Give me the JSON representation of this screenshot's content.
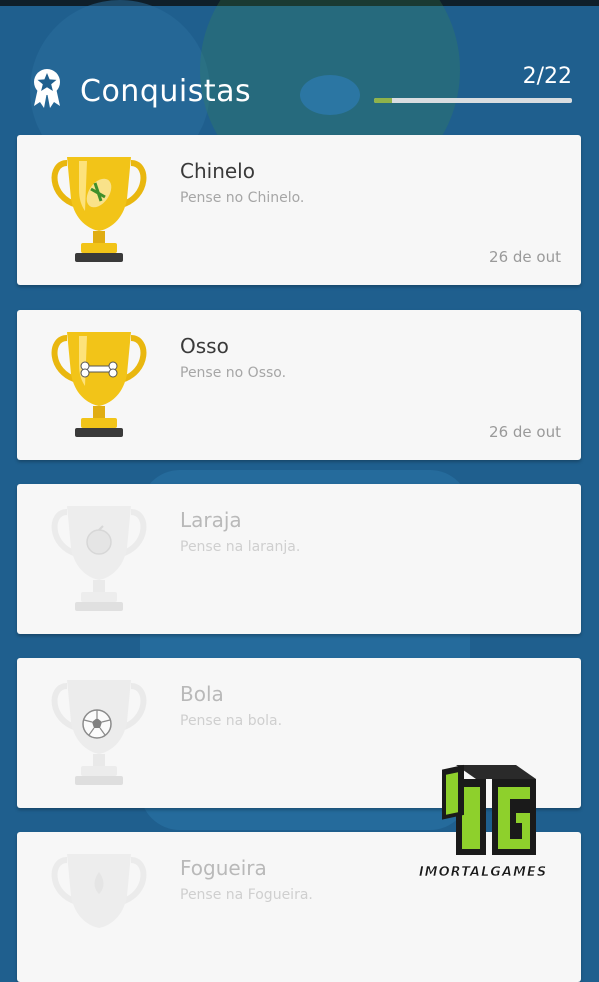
{
  "header": {
    "title": "Conquistas",
    "progress_text": "2/22",
    "progress_fraction": 0.091
  },
  "achievements": [
    {
      "title": "Chinelo",
      "description": "Pense no Chinelo.",
      "date": "26 de out",
      "unlocked": true,
      "emblem": "sandal-icon"
    },
    {
      "title": "Osso",
      "description": "Pense no Osso.",
      "date": "26 de out",
      "unlocked": true,
      "emblem": "bone-icon"
    },
    {
      "title": "Laraja",
      "description": "Pense na laranja.",
      "date": "",
      "unlocked": false,
      "emblem": "orange-icon"
    },
    {
      "title": "Bola",
      "description": "Pense na bola.",
      "date": "",
      "unlocked": false,
      "emblem": "soccer-ball-icon"
    },
    {
      "title": "Fogueira",
      "description": "Pense na Fogueira.",
      "date": "",
      "unlocked": false,
      "emblem": "campfire-icon"
    }
  ],
  "watermark": {
    "logo_text": "IMORTALGAMES",
    "monogram": "IG"
  },
  "colors": {
    "background": "#1f5f8e",
    "card": "#f7f7f7",
    "progress_fill": "#8fb24a",
    "trophy_gold": "#f2c418"
  }
}
